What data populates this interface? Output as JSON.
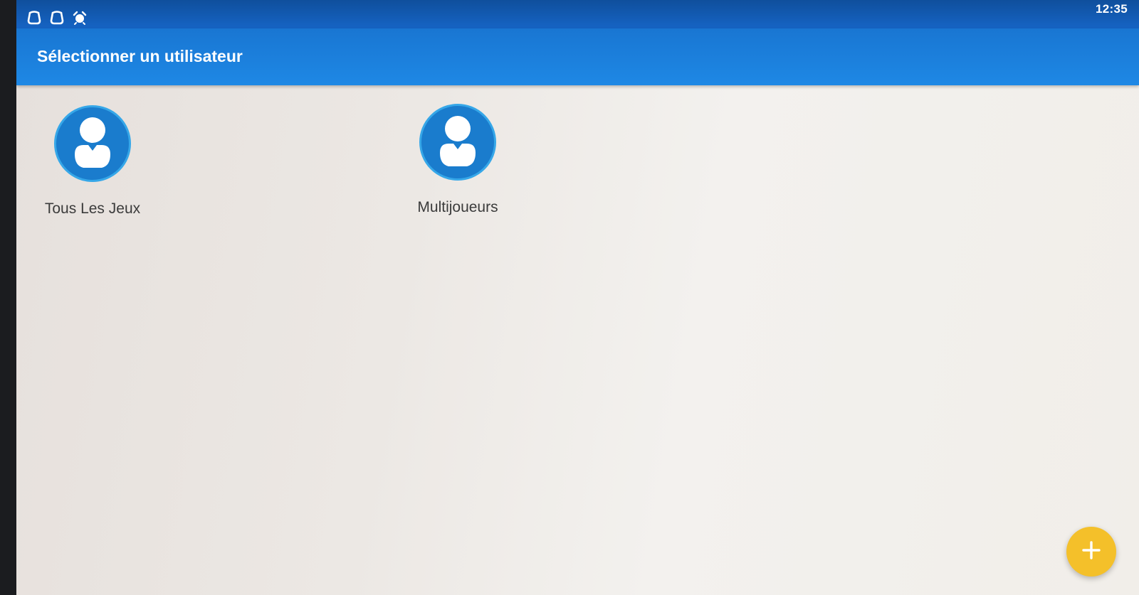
{
  "status_bar": {
    "time": "12:35",
    "icons": [
      "android-notification-icon",
      "android-notification-icon",
      "alarm-icon"
    ]
  },
  "app_bar": {
    "title": "Sélectionner un utilisateur"
  },
  "users": [
    {
      "name": "Tous Les Jeux",
      "icon": "user-avatar-icon"
    },
    {
      "name": "Multijoueurs",
      "icon": "user-avatar-icon"
    }
  ],
  "fab": {
    "icon": "plus-icon"
  },
  "colors": {
    "status_bar": "#1664c4",
    "app_bar": "#1e88e5",
    "avatar": "#1a7ccd",
    "avatar_ring": "#36a7e8",
    "fab": "#f4c02a"
  }
}
